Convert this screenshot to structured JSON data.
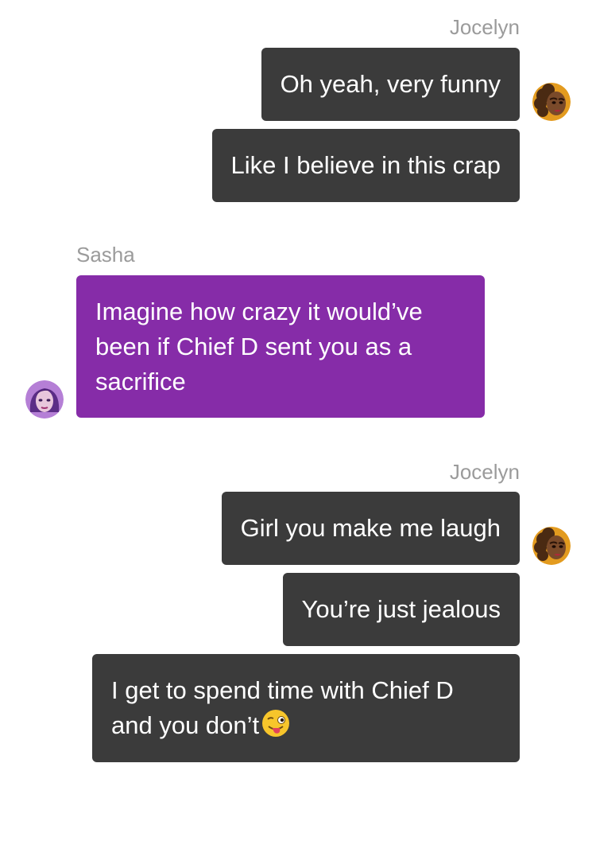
{
  "conversation": {
    "groups": [
      {
        "sender": "Jocelyn",
        "side": "right",
        "avatar": "jocelyn-avatar",
        "messages": [
          {
            "text": "Oh yeah, very funny"
          },
          {
            "text": "Like I believe in this crap"
          }
        ]
      },
      {
        "sender": "Sasha",
        "side": "left",
        "avatar": "sasha-avatar",
        "messages": [
          {
            "text": "Imagine how crazy it would’ve been if Chief D sent you as a sacrifice"
          }
        ]
      },
      {
        "sender": "Jocelyn",
        "side": "right",
        "avatar": "jocelyn-avatar",
        "messages": [
          {
            "text": "Girl you make me laugh"
          },
          {
            "text": "You’re just jealous"
          },
          {
            "text": "I get to spend time with Chief D and you don’t",
            "emoji": "winking-face-with-tongue"
          }
        ]
      }
    ]
  },
  "colors": {
    "my_bubble": "#3b3b3b",
    "their_bubble": "#862ca8",
    "sender_name": "#9b9b9b",
    "bubble_text": "#ffffff"
  }
}
